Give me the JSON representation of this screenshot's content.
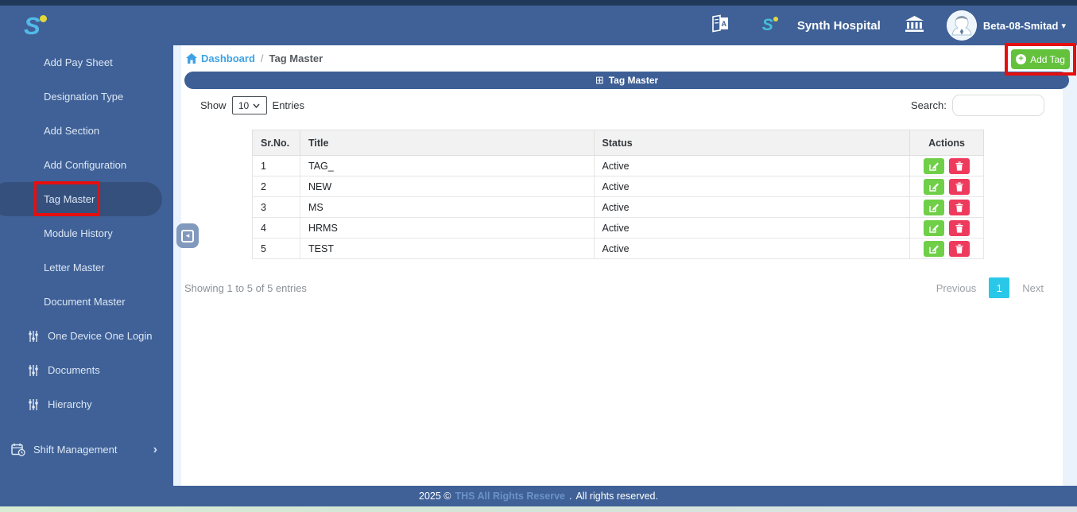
{
  "topbar": {
    "logo_letter": "S",
    "badge_letter": "S",
    "hospital_name": "Synth Hospital",
    "username": "Beta-08-Smitad",
    "caret": "▾"
  },
  "sidebar": {
    "items": [
      {
        "label": "Add Pay Sheet"
      },
      {
        "label": "Designation Type"
      },
      {
        "label": "Add Section"
      },
      {
        "label": "Add Configuration"
      },
      {
        "label": "Tag Master",
        "active": true
      },
      {
        "label": "Module History"
      },
      {
        "label": "Letter Master"
      },
      {
        "label": "Document Master"
      },
      {
        "label": "One Device One Login",
        "icon": "sliders"
      },
      {
        "label": "Documents",
        "icon": "sliders"
      },
      {
        "label": "Hierarchy",
        "icon": "sliders"
      },
      {
        "label": "Shift Management",
        "icon": "calendar-clock",
        "chevron": "›"
      }
    ]
  },
  "breadcrumb": {
    "home": "Dashboard",
    "separator": "/",
    "current": "Tag Master"
  },
  "toolbar": {
    "add_tag_label": "Add Tag",
    "plus": "+"
  },
  "panel": {
    "title": "Tag Master",
    "glyph": "⊞"
  },
  "controls": {
    "show_label": "Show",
    "per_page": "10",
    "entries_label": "Entries",
    "search_label": "Search:"
  },
  "table": {
    "headers": [
      "Sr.No.",
      "Title",
      "Status",
      "Actions"
    ],
    "rows": [
      {
        "sr": "1",
        "title": "TAG_",
        "status": "Active"
      },
      {
        "sr": "2",
        "title": "NEW",
        "status": "Active"
      },
      {
        "sr": "3",
        "title": "MS",
        "status": "Active"
      },
      {
        "sr": "4",
        "title": "HRMS",
        "status": "Active"
      },
      {
        "sr": "5",
        "title": "TEST",
        "status": "Active"
      }
    ]
  },
  "pagination": {
    "showing": "Showing 1 to 5 of 5 entries",
    "previous": "Previous",
    "page": "1",
    "next": "Next"
  },
  "footer": {
    "year": "2025 ©",
    "link": "THS All Rights Reserve",
    "dot": ".",
    "rights": "All rights reserved."
  },
  "colors": {
    "brand_blue": "#3f6197",
    "top_stripe": "#20395a",
    "active_pill": "#35507c",
    "page_bg": "#eaf3fc",
    "green": "#63c13c",
    "edit_green": "#70cf48",
    "delete_red": "#ee3a5c",
    "page_cyan": "#29c8e9",
    "link_blue": "#3ea2e5",
    "annotation_red": "#e60f0f"
  }
}
